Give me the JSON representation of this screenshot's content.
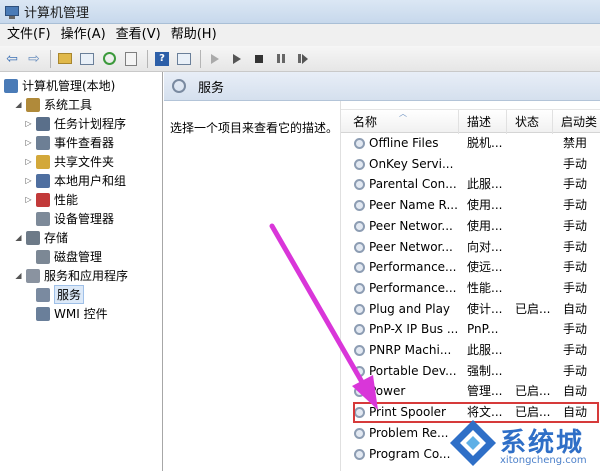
{
  "window": {
    "title": "计算机管理"
  },
  "menu": [
    "文件(F)",
    "操作(A)",
    "查看(V)",
    "帮助(H)"
  ],
  "tree": {
    "items": [
      {
        "label": "计算机管理(本地)",
        "level": 0,
        "expander": "",
        "icon": "computer-mgmt-icon",
        "color": "#4a7bb7"
      },
      {
        "label": "系统工具",
        "level": 1,
        "expander": "◢",
        "icon": "tools-icon",
        "color": "#b08a3a"
      },
      {
        "label": "任务计划程序",
        "level": 2,
        "expander": "▷",
        "icon": "clock-icon",
        "color": "#5a6f8a"
      },
      {
        "label": "事件查看器",
        "level": 2,
        "expander": "▷",
        "icon": "event-viewer-icon",
        "color": "#6d7f95"
      },
      {
        "label": "共享文件夹",
        "level": 2,
        "expander": "▷",
        "icon": "shared-folder-icon",
        "color": "#d3a83a"
      },
      {
        "label": "本地用户和组",
        "level": 2,
        "expander": "▷",
        "icon": "users-icon",
        "color": "#4f6fa0"
      },
      {
        "label": "性能",
        "level": 2,
        "expander": "▷",
        "icon": "performance-icon",
        "color": "#c23a3a"
      },
      {
        "label": "设备管理器",
        "level": 2,
        "expander": "",
        "icon": "device-manager-icon",
        "color": "#7d8a99"
      },
      {
        "label": "存储",
        "level": 1,
        "expander": "◢",
        "icon": "storage-icon",
        "color": "#6d7a88"
      },
      {
        "label": "磁盘管理",
        "level": 2,
        "expander": "",
        "icon": "disk-icon",
        "color": "#7c8895"
      },
      {
        "label": "服务和应用程序",
        "level": 1,
        "expander": "◢",
        "icon": "services-apps-icon",
        "color": "#8a93a0"
      },
      {
        "label": "服务",
        "level": 2,
        "expander": "",
        "icon": "gear-icon",
        "color": "#7a8aa0",
        "selected": true
      },
      {
        "label": "WMI 控件",
        "level": 2,
        "expander": "",
        "icon": "wmi-icon",
        "color": "#6a7f9a"
      }
    ]
  },
  "services_header": {
    "title": "服务"
  },
  "description": {
    "text": "选择一个项目来查看它的描述。"
  },
  "list": {
    "columns": [
      "名称",
      "描述",
      "状态",
      "启动类"
    ],
    "rows": [
      {
        "name": "Offline Files",
        "desc": "脱机...",
        "status": "",
        "startup": "禁用"
      },
      {
        "name": "OnKey Servi...",
        "desc": "",
        "status": "",
        "startup": "手动"
      },
      {
        "name": "Parental Con...",
        "desc": "此服...",
        "status": "",
        "startup": "手动"
      },
      {
        "name": "Peer Name R...",
        "desc": "使用...",
        "status": "",
        "startup": "手动"
      },
      {
        "name": "Peer Networ...",
        "desc": "使用...",
        "status": "",
        "startup": "手动"
      },
      {
        "name": "Peer Networ...",
        "desc": "向对...",
        "status": "",
        "startup": "手动"
      },
      {
        "name": "Performance...",
        "desc": "使远...",
        "status": "",
        "startup": "手动"
      },
      {
        "name": "Performance...",
        "desc": "性能...",
        "status": "",
        "startup": "手动"
      },
      {
        "name": "Plug and Play",
        "desc": "使计...",
        "status": "已启...",
        "startup": "自动"
      },
      {
        "name": "PnP-X IP Bus ...",
        "desc": "PnP...",
        "status": "",
        "startup": "手动"
      },
      {
        "name": "PNRP Machi...",
        "desc": "此服...",
        "status": "",
        "startup": "手动"
      },
      {
        "name": "Portable Dev...",
        "desc": "强制...",
        "status": "",
        "startup": "手动"
      },
      {
        "name": "Power",
        "desc": "管理...",
        "status": "已启...",
        "startup": "自动"
      },
      {
        "name": "Print Spooler",
        "desc": "将文...",
        "status": "已启...",
        "startup": "自动",
        "highlight": true
      },
      {
        "name": "Problem Re...",
        "desc": "",
        "status": "",
        "startup": ""
      },
      {
        "name": "Program Co...",
        "desc": "",
        "status": "",
        "startup": ""
      }
    ]
  },
  "watermark": {
    "brand": "系统城",
    "url": "xitongcheng.com"
  },
  "colors": {
    "highlight_border": "#d63a3a",
    "arrow": "#d936d9",
    "accent": "#2f6fc7"
  }
}
